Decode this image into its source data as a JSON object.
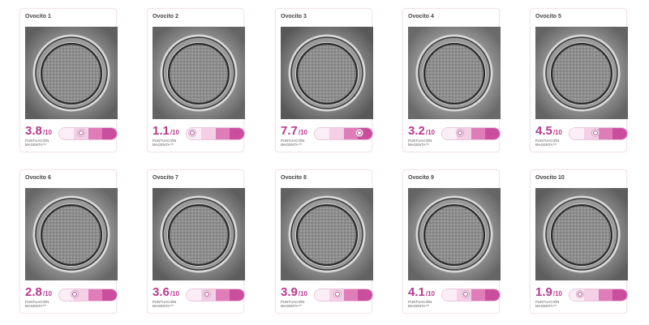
{
  "score_unit": "/10",
  "caption": "PUNTUACIÓN MAGENTA™",
  "colors": {
    "accent": "#b8398f",
    "segments": [
      "#fbeef6",
      "#f4cfe5",
      "#e07cb8",
      "#c94f9e"
    ]
  },
  "cards": [
    {
      "title": "Ovocito 1",
      "score": "3.8",
      "value": 0.38
    },
    {
      "title": "Ovocito 2",
      "score": "1.1",
      "value": 0.11
    },
    {
      "title": "Ovocito 3",
      "score": "7.7",
      "value": 0.77
    },
    {
      "title": "Ovocito 4",
      "score": "3.2",
      "value": 0.32
    },
    {
      "title": "Ovocito 5",
      "score": "4.5",
      "value": 0.45
    },
    {
      "title": "Ovocito 6",
      "score": "2.8",
      "value": 0.28
    },
    {
      "title": "Ovocito 7",
      "score": "3.6",
      "value": 0.36
    },
    {
      "title": "Ovocito 8",
      "score": "3.9",
      "value": 0.39
    },
    {
      "title": "Ovocito 9",
      "score": "4.1",
      "value": 0.41
    },
    {
      "title": "Ovocito 10",
      "score": "1.9",
      "value": 0.19
    }
  ]
}
